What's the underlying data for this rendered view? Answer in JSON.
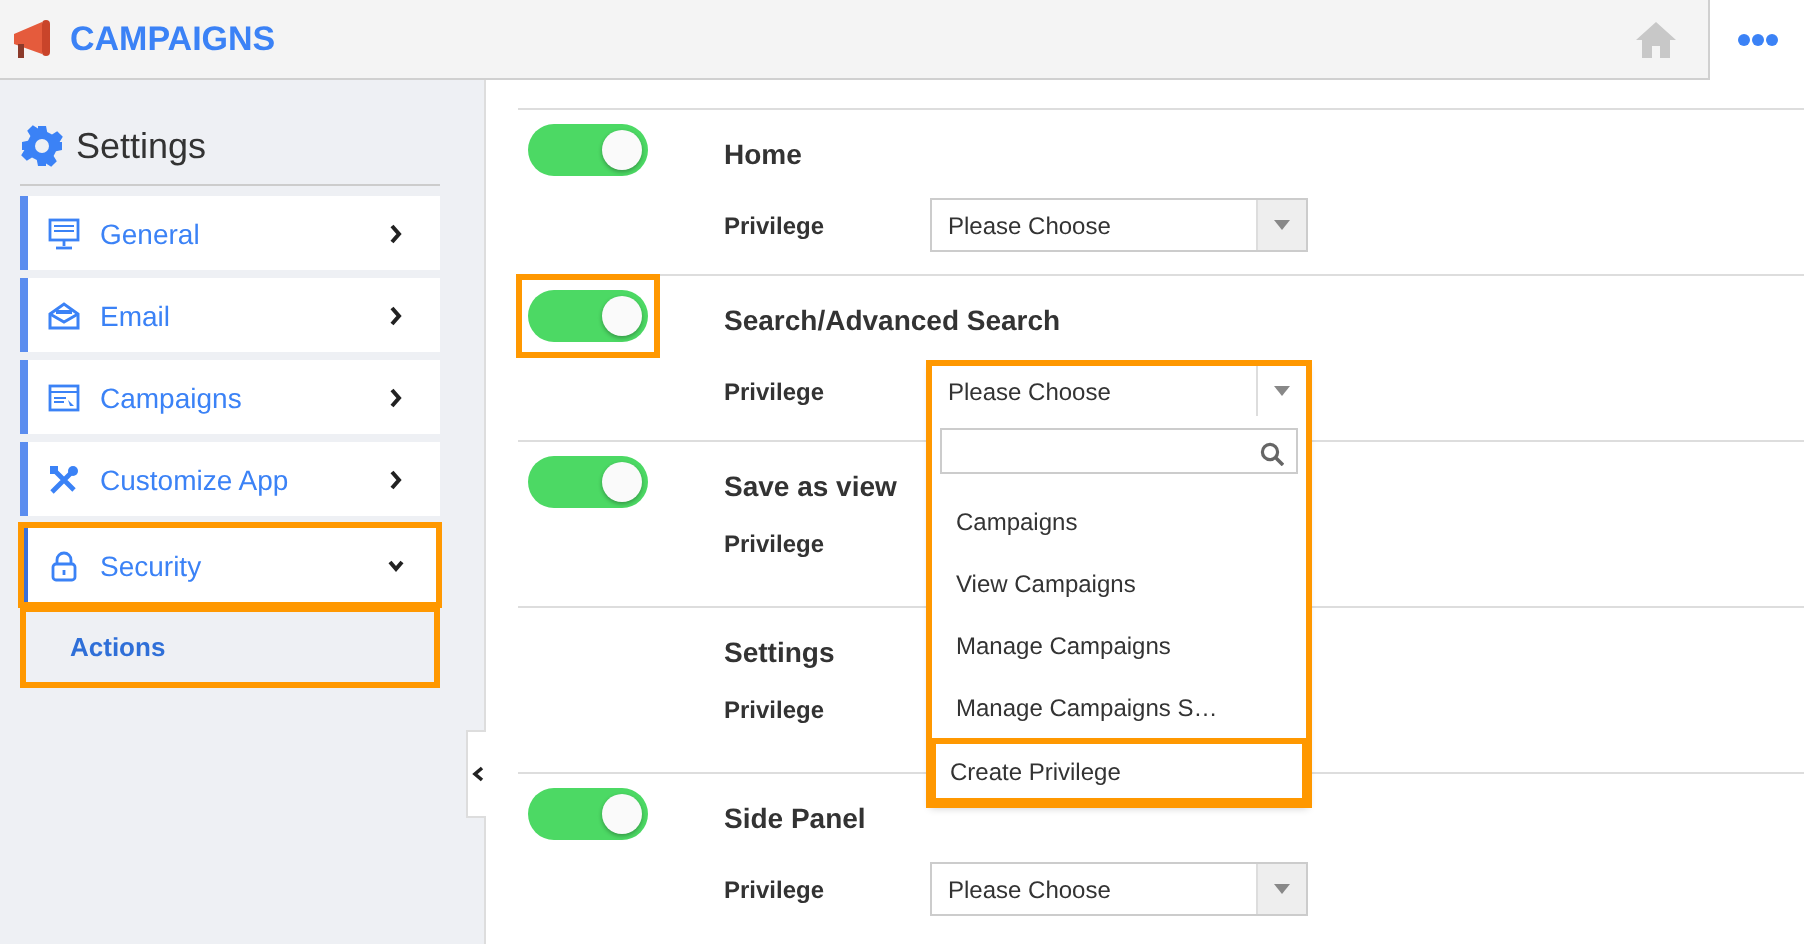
{
  "header": {
    "app_title": "CAMPAIGNS"
  },
  "sidebar": {
    "title": "Settings",
    "items": [
      {
        "label": "General",
        "expanded": false,
        "highlighted": false
      },
      {
        "label": "Email",
        "expanded": false,
        "highlighted": false
      },
      {
        "label": "Campaigns",
        "expanded": false,
        "highlighted": false
      },
      {
        "label": "Customize App",
        "expanded": false,
        "highlighted": false
      },
      {
        "label": "Security",
        "expanded": true,
        "highlighted": true,
        "children": [
          {
            "label": "Actions",
            "selected": true,
            "highlighted": true
          }
        ]
      }
    ]
  },
  "actions": [
    {
      "title": "Home",
      "toggle": {
        "on": true,
        "highlighted": false
      },
      "privilege_label": "Privilege",
      "select": {
        "value": "Please Choose",
        "open": false
      }
    },
    {
      "title": "Search/Advanced Search",
      "toggle": {
        "on": true,
        "highlighted": true
      },
      "privilege_label": "Privilege",
      "select": {
        "value": "Please Choose",
        "open": true,
        "highlighted": true,
        "options": [
          "Campaigns",
          "View Campaigns",
          "Manage Campaigns",
          "Manage Campaigns S…"
        ],
        "footer": {
          "label": "Create Privilege",
          "highlighted": true
        }
      }
    },
    {
      "title": "Save as view",
      "toggle": {
        "on": true,
        "highlighted": false
      },
      "privilege_label": "Privilege"
    },
    {
      "title": "Settings",
      "privilege_label": "Privilege"
    },
    {
      "title": "Side Panel",
      "toggle": {
        "on": true,
        "highlighted": false
      },
      "privilege_label": "Privilege",
      "select": {
        "value": "Please Choose",
        "open": false
      }
    }
  ]
}
